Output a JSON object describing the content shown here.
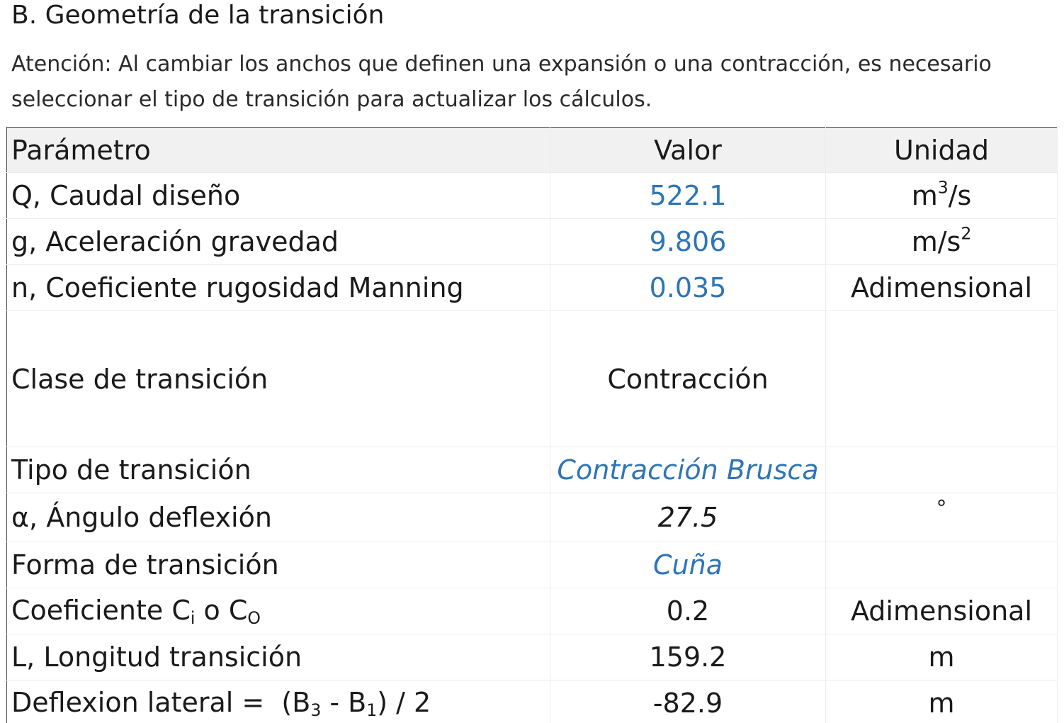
{
  "section": {
    "title": "B. Geometría de la transición",
    "note": "Atención: Al cambiar los anchos que definen una expansión o una contracción, es necesario seleccionar el tipo de transición para actualizar los cálculos."
  },
  "table": {
    "headers": [
      "Parámetro",
      "Valor",
      "Unidad"
    ],
    "rows": {
      "caudal": {
        "param": "Q, Caudal diseño",
        "value": "522.1",
        "unit_base": "m",
        "unit_sup": "3",
        "unit_tail": "/s"
      },
      "gravedad": {
        "param": "g, Aceleración gravedad",
        "value": "9.806",
        "unit_base": "m/s",
        "unit_sup": "2"
      },
      "manning": {
        "param": "n, Coeficiente rugosidad Manning",
        "value": "0.035",
        "unit": "Adimensional"
      },
      "clase": {
        "param": "Clase de transición",
        "value": "Contracción",
        "unit": ""
      },
      "tipo": {
        "param": "Tipo de transición",
        "value": "Contracción Brusca",
        "unit": ""
      },
      "angulo": {
        "param": "α, Ángulo deflexión",
        "value": "27.5",
        "unit": "°"
      },
      "forma": {
        "param": "Forma de transición",
        "value": "Cuña",
        "unit": ""
      },
      "coef": {
        "param_pre": "Coeficiente C",
        "param_sub1": "i",
        "param_mid": " o C",
        "param_sub2": "O",
        "value": "0.2",
        "unit": "Adimensional"
      },
      "longitud": {
        "param": "L, Longitud transición",
        "value": "159.2",
        "unit": "m"
      },
      "deflexion": {
        "param_pre": "Deflexion lateral =  (B",
        "param_sub1": "3",
        "param_mid": " - B",
        "param_sub2": "1",
        "param_tail": ") / 2",
        "value": "-82.9",
        "unit": "m"
      }
    }
  },
  "colors": {
    "input_blue": "#2e75b6",
    "header_bg": "#f1f1f1"
  }
}
